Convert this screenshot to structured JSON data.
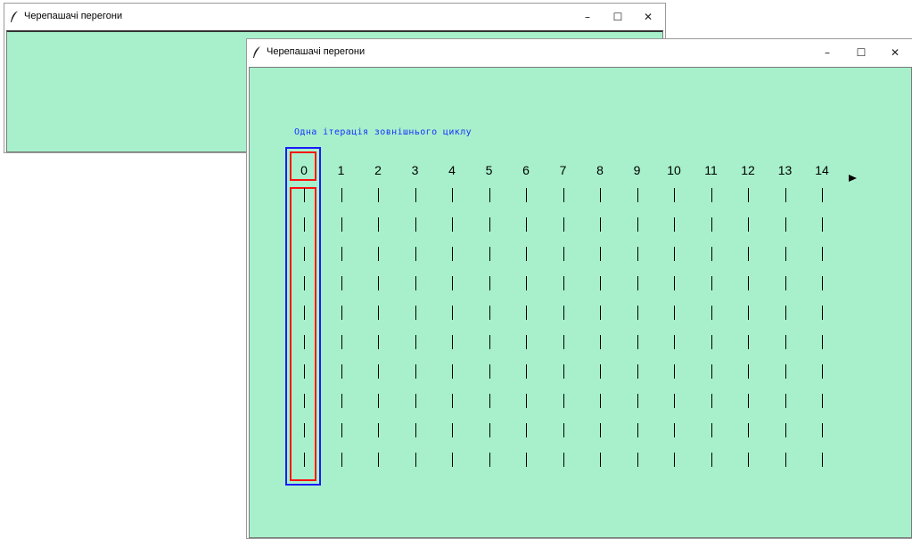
{
  "colors": {
    "canvas_bg": "#a7f0cb",
    "text_blue": "#1a2fff",
    "box_blue": "#1a1aff",
    "box_red": "#ff1111"
  },
  "back_window": {
    "title": "Черепашачі перегони",
    "icon": "feather-icon",
    "minimize": "–",
    "maximize": "☐",
    "close": "✕"
  },
  "front_window": {
    "title": "Черепашачі перегони",
    "icon": "feather-icon",
    "minimize": "–",
    "maximize": "☐",
    "close": "✕"
  },
  "canvas": {
    "subtitle": "Одна ітерація зовнішнього циклу",
    "numbers": [
      "0",
      "1",
      "2",
      "3",
      "4",
      "5",
      "6",
      "7",
      "8",
      "9",
      "10",
      "11",
      "12",
      "13",
      "14"
    ],
    "tick_rows": 10,
    "turtle": "turtle-arrow-icon"
  }
}
